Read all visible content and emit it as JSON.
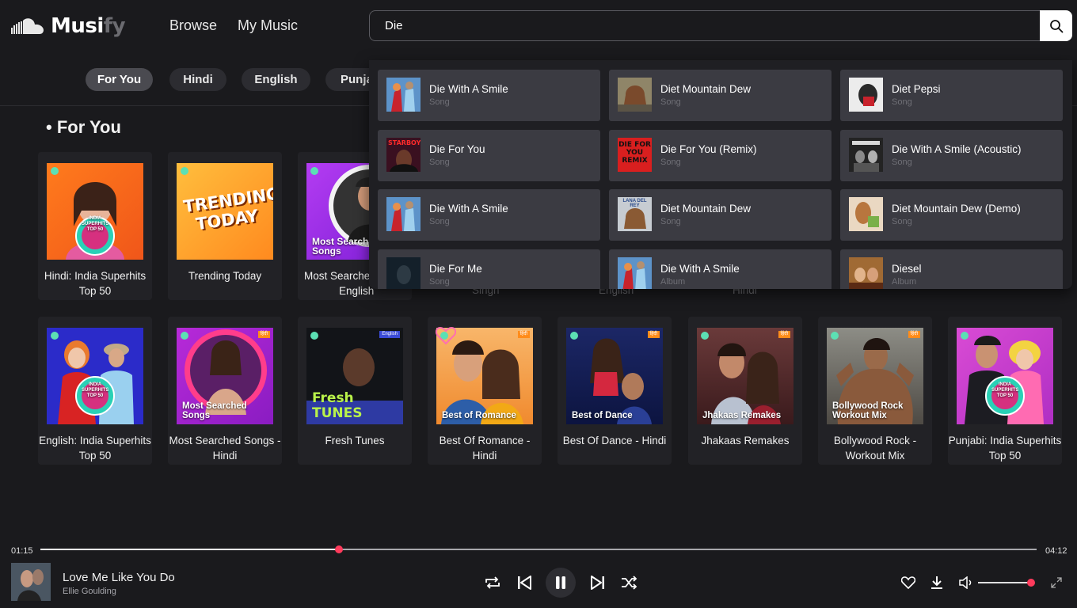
{
  "app": {
    "logo_part1": "Musi",
    "logo_part2": "fy"
  },
  "nav": {
    "browse": "Browse",
    "my_music": "My Music"
  },
  "search": {
    "value": "Die"
  },
  "chips": [
    "For You",
    "Hindi",
    "English",
    "Punjabi"
  ],
  "section_title": "• For You",
  "row1_cards": [
    {
      "title_line1": "Hindi: India Superhits",
      "title_line2": "Top 50",
      "cover_text": "INDIA SUPERHITS TOP 50",
      "cover_sub": "हिंदी"
    },
    {
      "title_line1": "Trending Today",
      "title_line2": "",
      "cover_text": "TRENDING TODAY"
    },
    {
      "title_line1": "Most Searched",
      "title_line2": "English",
      "cover_text": "Most Searched Songs"
    }
  ],
  "row1_hidden_labels": [
    "Singh",
    "English",
    "Hindi"
  ],
  "row2_cards": [
    {
      "title_line1": "English: India Superhits",
      "title_line2": "Top 50",
      "cover_text": "INDIA SUPERHITS TOP 50",
      "cover_sub": "English"
    },
    {
      "title_line1": "Most Searched Songs -",
      "title_line2": "Hindi",
      "cover_text": "Most Searched Songs",
      "tag": "हिंदी"
    },
    {
      "title_line1": "Fresh Tunes",
      "title_line2": "",
      "cover_text": "Fresh TUNES",
      "tag": "English"
    },
    {
      "title_line1": "Best Of Romance - Hindi",
      "title_line2": "",
      "cover_text": "Best of Romance",
      "tag": "हिंदी"
    },
    {
      "title_line1": "Best Of Dance - Hindi",
      "title_line2": "",
      "cover_text": "Best of Dance",
      "tag": "हिंदी"
    },
    {
      "title_line1": "Jhakaas Remakes",
      "title_line2": "",
      "cover_text": "Jhakaas Remakes",
      "tag": "हिंदी"
    },
    {
      "title_line1": "Bollywood Rock -",
      "title_line2": "Workout Mix",
      "cover_text": "Bollywood Rock Workout Mix",
      "tag": "हिंदी"
    },
    {
      "title_line1": "Punjabi: India Superhits",
      "title_line2": "Top 50",
      "cover_text": "INDIA SUPERHITS TOP 50",
      "cover_sub": "ਪੰਜਾਬੀ"
    }
  ],
  "suggestions": [
    {
      "title": "Die With A Smile",
      "type": "Song"
    },
    {
      "title": "Diet Mountain Dew",
      "type": "Song"
    },
    {
      "title": "Diet Pepsi",
      "type": "Song"
    },
    {
      "title": "Die For You",
      "type": "Song"
    },
    {
      "title": "Die For You (Remix)",
      "type": "Song"
    },
    {
      "title": "Die With A Smile (Acoustic)",
      "type": "Song"
    },
    {
      "title": "Die With A Smile",
      "type": "Song"
    },
    {
      "title": "Diet Mountain Dew",
      "type": "Song"
    },
    {
      "title": "Diet Mountain Dew (Demo)",
      "type": "Song"
    },
    {
      "title": "Die For Me",
      "type": "Song"
    },
    {
      "title": "Die With A Smile",
      "type": "Album"
    },
    {
      "title": "Diesel",
      "type": "Album"
    }
  ],
  "suggestion_thumb_text": {
    "starboy": "STARBOY",
    "die_for_you_remix": "DIE FOR YOU REMIX",
    "lana": "LANA DEL REY"
  },
  "player": {
    "current_time": "01:15",
    "total_time": "04:12",
    "progress_fraction": 0.3,
    "track_title": "Love Me Like You Do",
    "artist": "Ellie Goulding",
    "volume_fraction": 1.0
  },
  "colors": {
    "accent": "#ff3b5c",
    "background": "#1a1a1d",
    "card": "#222226",
    "suggestion": "#3b3b42"
  }
}
